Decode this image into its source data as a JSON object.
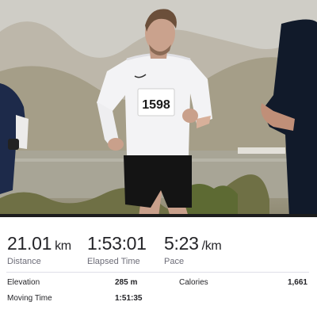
{
  "activity": {
    "photo_description_icon": "running-photo",
    "bib_number": "1598"
  },
  "summary": {
    "distance": {
      "value": "21.01",
      "unit": "km",
      "label": "Distance"
    },
    "elapsed_time": {
      "value": "1:53:01",
      "label": "Elapsed Time"
    },
    "pace": {
      "value": "5:23",
      "unit": "/km",
      "label": "Pace"
    }
  },
  "details": {
    "elevation": {
      "label": "Elevation",
      "value": "285 m"
    },
    "calories": {
      "label": "Calories",
      "value": "1,661"
    },
    "moving_time": {
      "label": "Moving Time",
      "value": "1:51:35"
    }
  }
}
